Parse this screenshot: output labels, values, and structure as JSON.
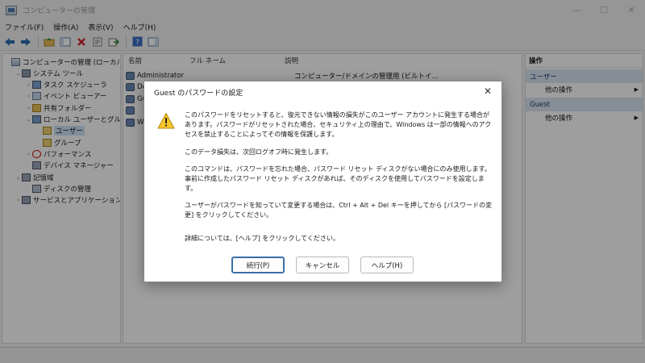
{
  "window": {
    "title": "コンピューターの管理",
    "controls": [
      "—",
      "☐",
      "✕"
    ]
  },
  "menu": [
    "ファイル(F)",
    "操作(A)",
    "表示(V)",
    "ヘルプ(H)"
  ],
  "toolbar": [
    "back-arrow-icon",
    "forward-arrow-icon",
    "up-folder-icon",
    "show-tree-icon",
    "delete-icon",
    "properties-icon",
    "export-icon",
    "help-icon",
    "view-icon"
  ],
  "tree": [
    {
      "label": "コンピューターの管理 (ローカル)",
      "depth": 0,
      "caret": ""
    },
    {
      "label": "システム ツール",
      "depth": 1,
      "caret": "⌄"
    },
    {
      "label": "タスク スケジューラ",
      "depth": 2,
      "caret": "›"
    },
    {
      "label": "イベント ビューアー",
      "depth": 2,
      "caret": "›"
    },
    {
      "label": "共有フォルダー",
      "depth": 2,
      "caret": "›"
    },
    {
      "label": "ローカル ユーザーとグループ",
      "depth": 2,
      "caret": "⌄"
    },
    {
      "label": "ユーザー",
      "depth": 3,
      "caret": "",
      "selected": true
    },
    {
      "label": "グループ",
      "depth": 3,
      "caret": ""
    },
    {
      "label": "パフォーマンス",
      "depth": 2,
      "caret": "›"
    },
    {
      "label": "デバイス マネージャー",
      "depth": 2,
      "caret": ""
    },
    {
      "label": "記憶域",
      "depth": 1,
      "caret": "⌄"
    },
    {
      "label": "ディスクの管理",
      "depth": 2,
      "caret": ""
    },
    {
      "label": "サービスとアプリケーション",
      "depth": 1,
      "caret": "›"
    }
  ],
  "list": {
    "columns": [
      "名前",
      "フル ネーム",
      "説明"
    ],
    "rows": [
      {
        "name": "Administrator",
        "desc": "コンピューター/ドメインの管理用 (ビルトイ..."
      },
      {
        "name": "De",
        "desc": ""
      },
      {
        "name": "Gu",
        "desc": ""
      },
      {
        "name": "",
        "desc": ""
      },
      {
        "name": "W",
        "desc": ""
      }
    ]
  },
  "actions": {
    "title": "操作",
    "sections": [
      {
        "label": "ユーザー",
        "link": "他の操作"
      },
      {
        "label": "Guest",
        "link": "他の操作"
      }
    ]
  },
  "dialog": {
    "title": "Guest のパスワードの設定",
    "close": "✕",
    "paragraphs": [
      "このパスワードをリセットすると、復元できない情報の損失がこのユーザー アカウントに発生する場合があります。パスワードがリセットされた場合、セキュリティ上の理由で、Windows は一部の情報へのアクセスを禁止することによってその情報を保護します。",
      "このデータ損失は、次回ログオフ時に発生します。",
      "このコマンドは、パスワードを忘れた場合、パスワード リセット ディスクがない場合にのみ使用します。事前に作成したパスワード リセット ディスクがあれば、そのディスクを使用してパスワードを設定します。",
      "ユーザーがパスワードを知っていて変更する場合は、Ctrl + Alt + Del キーを押してから [パスワードの変更] をクリックしてください。",
      "詳細については、[ヘルプ] をクリックしてください。"
    ],
    "buttons": {
      "continue": "続行(P)",
      "cancel": "キャンセル",
      "help": "ヘルプ(H)"
    }
  }
}
